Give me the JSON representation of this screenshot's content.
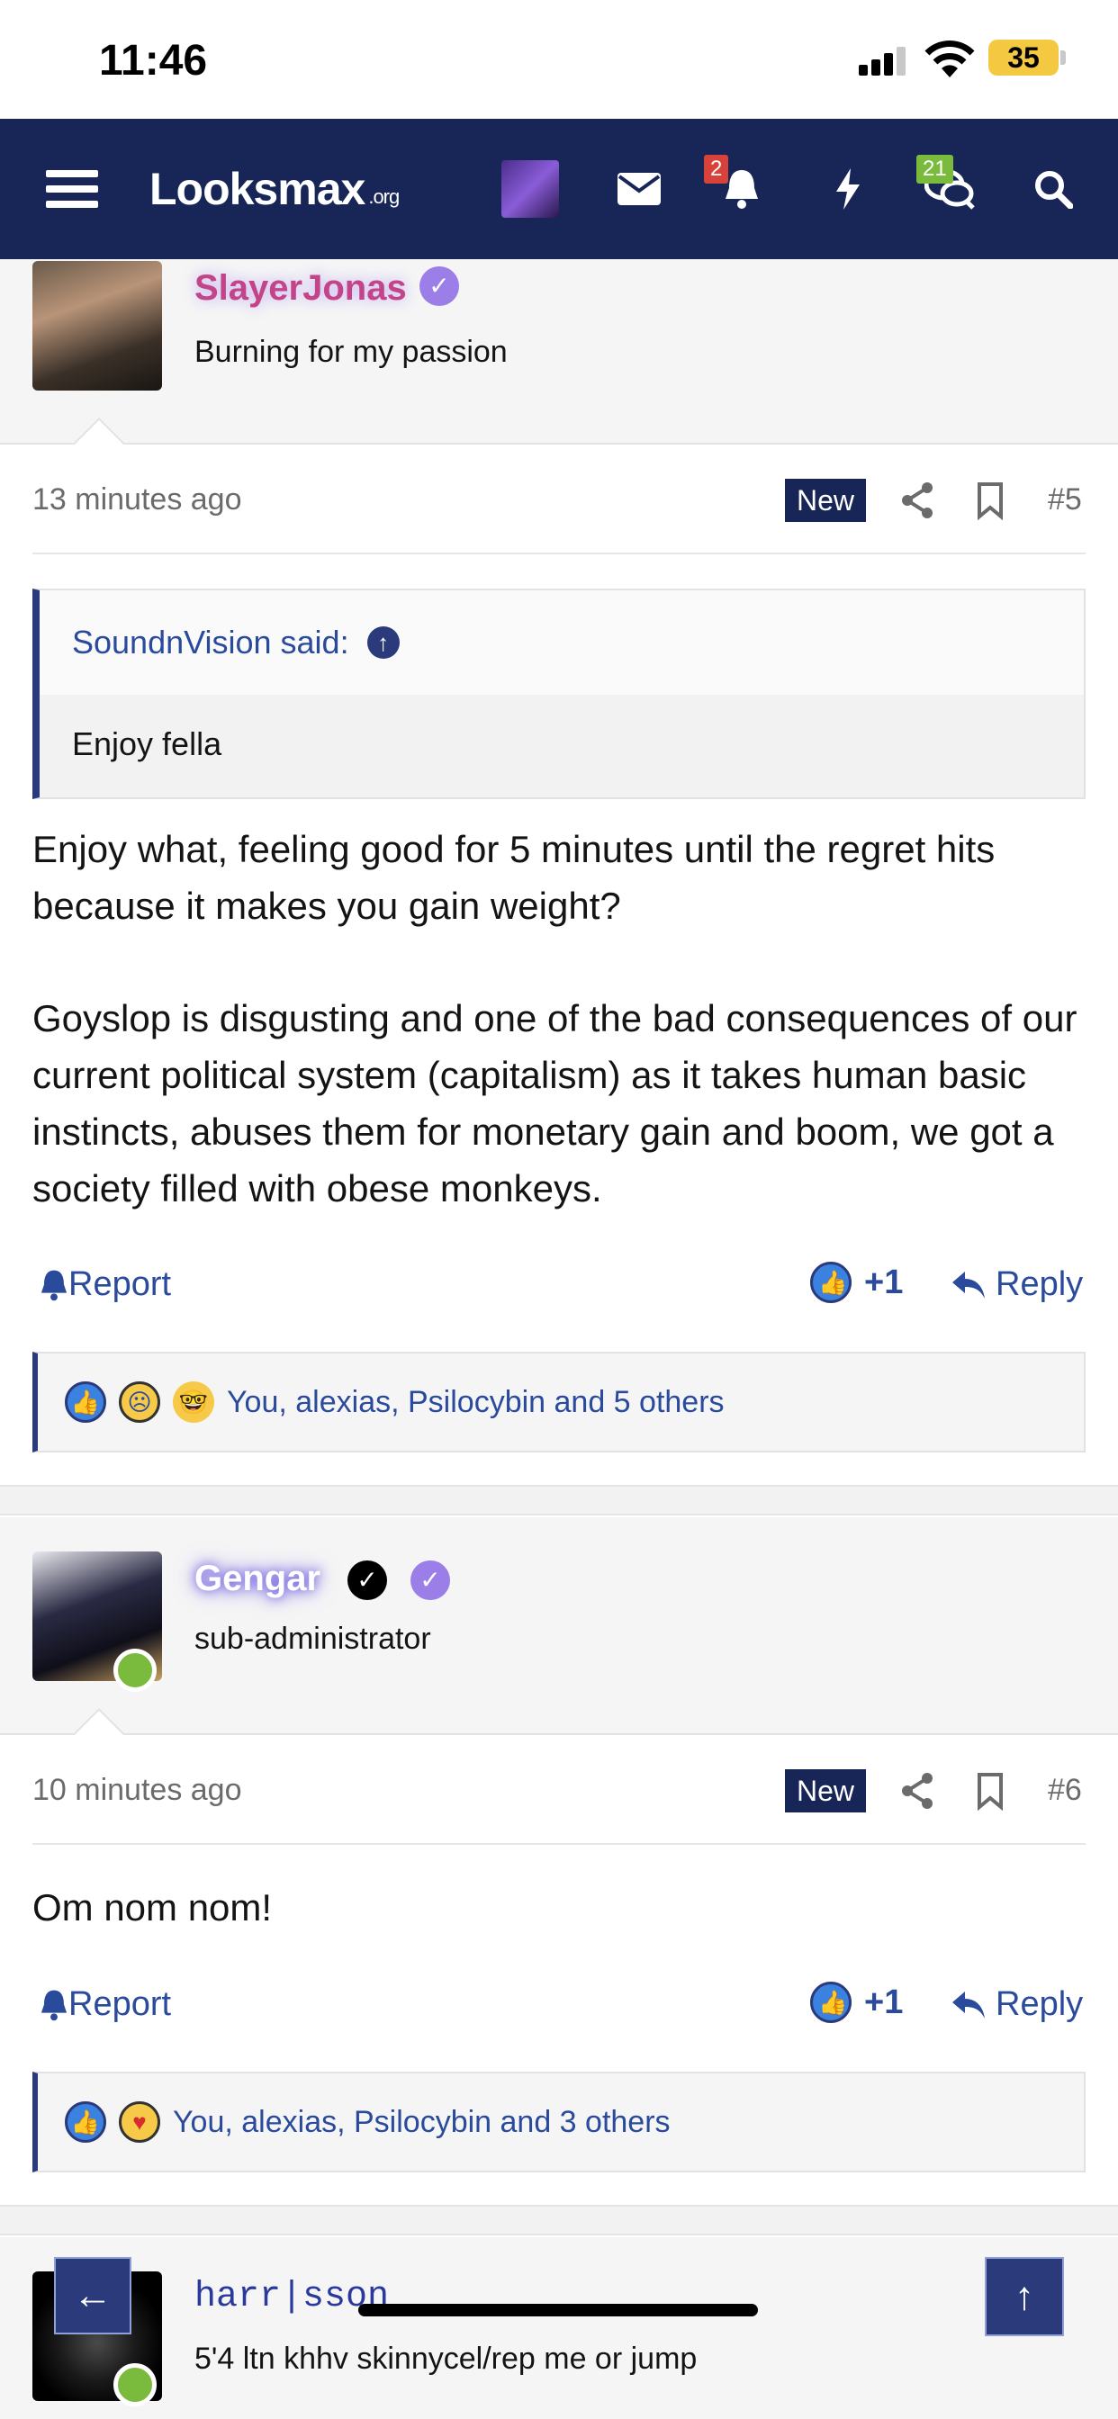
{
  "status_bar": {
    "time": "11:46",
    "battery": "35"
  },
  "nav": {
    "logo": "Looksmax",
    "logo_suffix": ".org",
    "alerts_badge": "2",
    "conversations_badge": "21",
    "icons": [
      "menu-icon",
      "user-avatar",
      "envelope-icon",
      "bell-icon",
      "bolt-icon",
      "chat-icon",
      "search-icon"
    ]
  },
  "posts": [
    {
      "username": "SlayerJonas",
      "user_title": "Burning for my passion",
      "time": "13 minutes ago",
      "new_label": "New",
      "post_number": "#5",
      "quote": {
        "author": "SoundnVision said:",
        "text": "Enjoy fella"
      },
      "text_p1": "Enjoy what, feeling good for 5 minutes until the regret hits because it makes you gain weight?",
      "text_p2": "Goyslop is disgusting and one of the bad consequences of our current political system (capitalism) as it takes human basic instincts, abuses them for monetary gain and boom, we got a society filled with obese monkeys.",
      "report": "Report",
      "like_count": "+1",
      "reply": "Reply",
      "reactions_text": "You, alexias, Psilocybin and 5 others"
    },
    {
      "username": "Gengar",
      "user_title": "sub-administrator",
      "time": "10 minutes ago",
      "new_label": "New",
      "post_number": "#6",
      "text_p1": "Om nom nom!",
      "report": "Report",
      "like_count": "+1",
      "reply": "Reply",
      "reactions_text": "You, alexias, Psilocybin and 3 others"
    },
    {
      "username": "harr|sson",
      "user_title": "5'4 ltn khhv skinnycel/rep me or jump"
    }
  ],
  "colors": {
    "nav_bg": "#172557",
    "link": "#2a4a9c",
    "online": "#7aba3c",
    "verified": "#9b7ee8"
  }
}
